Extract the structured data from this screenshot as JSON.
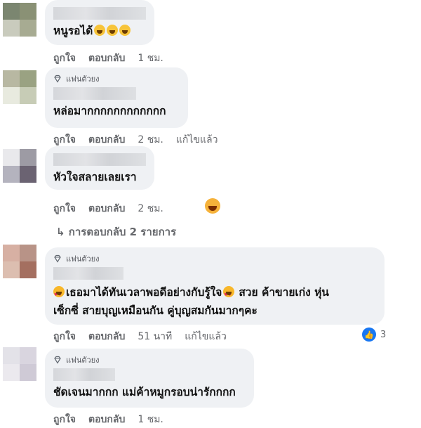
{
  "actions": {
    "like": "ถูกใจ",
    "reply": "ตอบกลับ",
    "edited": "แก้ไขแล้ว"
  },
  "fan_badge": "แฟนตัวยง",
  "colors": {
    "bubble": "#eff1f4",
    "muted_text": "#65676b",
    "like_blue": "#1877f2"
  },
  "comments": [
    {
      "text": "หนูรอได้",
      "time": "1 ชม."
    },
    {
      "text": "หล่อมากกกกกกกกกกกก",
      "time": "2 ชม."
    },
    {
      "text": "หัวใจสลายเลยเรา",
      "time": "2 ชม."
    },
    {
      "text_line1_a": "เธอมาได้ทันเวลาพอดีอย่างกับรู้ใจ",
      "text_line1_b": "สวย ค้าขายเก่ง หุ่น",
      "text_line2": "เซ็กซี่ สายบุญเหมือนกัน คู่บุญสมกันมากๆคะ",
      "time": "51 นาที",
      "reactions": "3"
    },
    {
      "text": "ชัดเจนมากกก แม่ค้าหมูกรอบน่ารักกกก",
      "time": "1 ชม."
    }
  ],
  "replies_link": "↳ การตอบกลับ 2 รายการ"
}
